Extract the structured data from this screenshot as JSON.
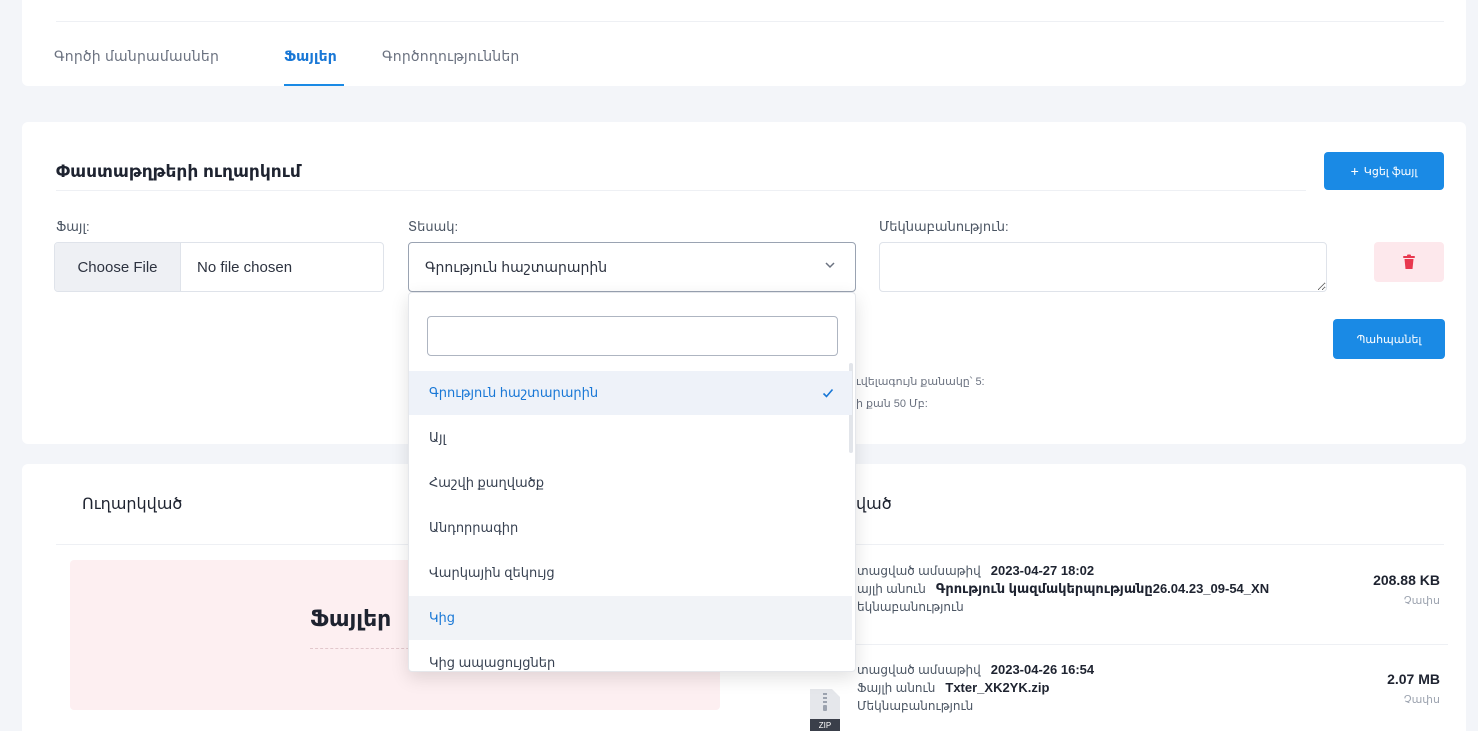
{
  "tabs": [
    {
      "label": "Գործի մանրամասներ"
    },
    {
      "label": "Ֆայլեր"
    },
    {
      "label": "Գործողություններ"
    }
  ],
  "upload": {
    "title": "Փաստաթղթերի ուղարկում",
    "add_file_label": "Կցել ֆայլ",
    "file_label": "Ֆայլ:",
    "type_label": "Տեսակ:",
    "description_label": "Մեկնաբանություն:",
    "choose_file": "Choose File",
    "no_file": "No file chosen",
    "selected_type": "Գրություն հաշտարարին",
    "submit_label": "Պահպանել",
    "hint_1": "ւվելագույն քանակը՝ 5:",
    "hint_2": "ի քան 50 Մբ:"
  },
  "dropdown": {
    "search_value": "",
    "options": [
      {
        "label": "Գրություն հաշտարարին"
      },
      {
        "label": "Այլ"
      },
      {
        "label": "Հաշվի քաղվածք"
      },
      {
        "label": "Անդորրագիր"
      },
      {
        "label": "Վարկային զեկույց"
      },
      {
        "label": "Կից"
      },
      {
        "label": "Կից ապացույցներ"
      }
    ]
  },
  "files": {
    "sent_title": "Ուղարկված",
    "received_title": "ված",
    "empty_text": "Ֆայլեր",
    "size_caption": "Չափս",
    "rows": [
      {
        "date_label": "տացված ամսաթիվ",
        "date": "2023-04-27 18:02",
        "name_label": "այլի անուն",
        "name": "Գրություն կազմակերպությանը26.04.23_09-54_XN",
        "comment_label": "եկնաբանություն",
        "size": "208.88 KB"
      },
      {
        "date_label": "տացված ամսաթիվ",
        "date": "2023-04-26 16:54",
        "name_label": "Ֆայլի անուն",
        "name": "Txter_XK2YK.zip",
        "comment_label": "Մեկնաբանություն",
        "size": "2.07 MB",
        "icon_text": "ZIP"
      }
    ]
  },
  "colors": {
    "accent": "#1a8ae5",
    "danger": "#e8384f",
    "empty_bg": "#fdeff1"
  }
}
